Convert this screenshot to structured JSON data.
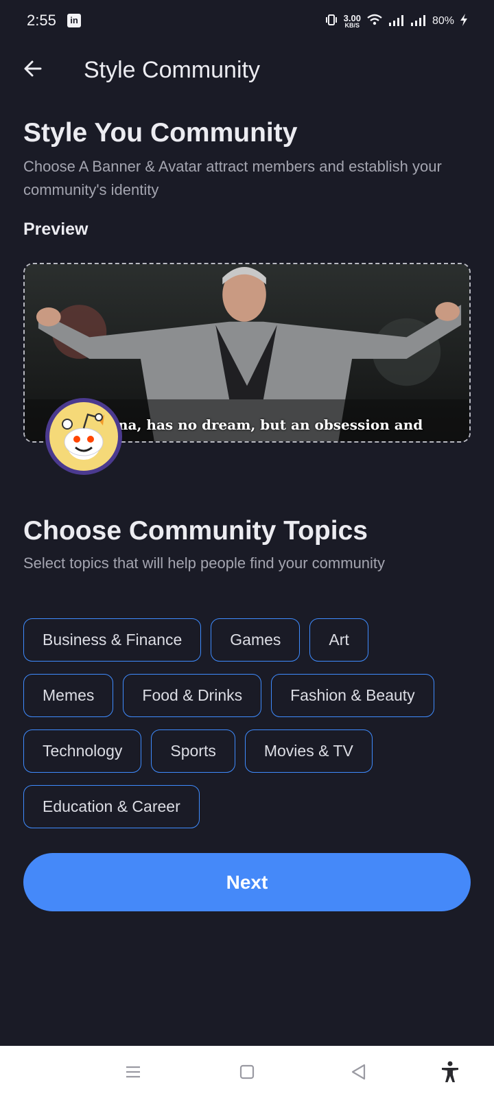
{
  "status_bar": {
    "time": "2:55",
    "app_badge": "in",
    "net_speed_value": "3.00",
    "net_speed_unit": "KB/S",
    "battery": "80%"
  },
  "app_bar": {
    "title": "Style Community",
    "back_icon": "arrow-left-icon"
  },
  "style_section": {
    "heading": "Style You Community",
    "subtitle": "Choose A Banner & Avatar attract members and establish your community's identity",
    "preview_label": "Preview",
    "banner_caption": "na, has no dream, but an obsession and"
  },
  "topics_section": {
    "heading": "Choose Community Topics",
    "subtitle": "Select topics that will help people find your community",
    "rows": [
      [
        "Business & Finance",
        "Games",
        "Art"
      ],
      [
        "Memes",
        "Food & Drinks",
        "Fashion & Beauty"
      ],
      [
        "Technology",
        "Sports",
        "Movies & TV"
      ],
      [
        "Education & Career"
      ]
    ]
  },
  "next_button": "Next",
  "nav_bar": {
    "icons": [
      "menu-icon",
      "home-square-icon",
      "back-triangle-icon",
      "accessibility-icon"
    ]
  },
  "colors": {
    "background": "#1a1b26",
    "accent": "#4589f9",
    "chip_border": "#3f8cff"
  }
}
